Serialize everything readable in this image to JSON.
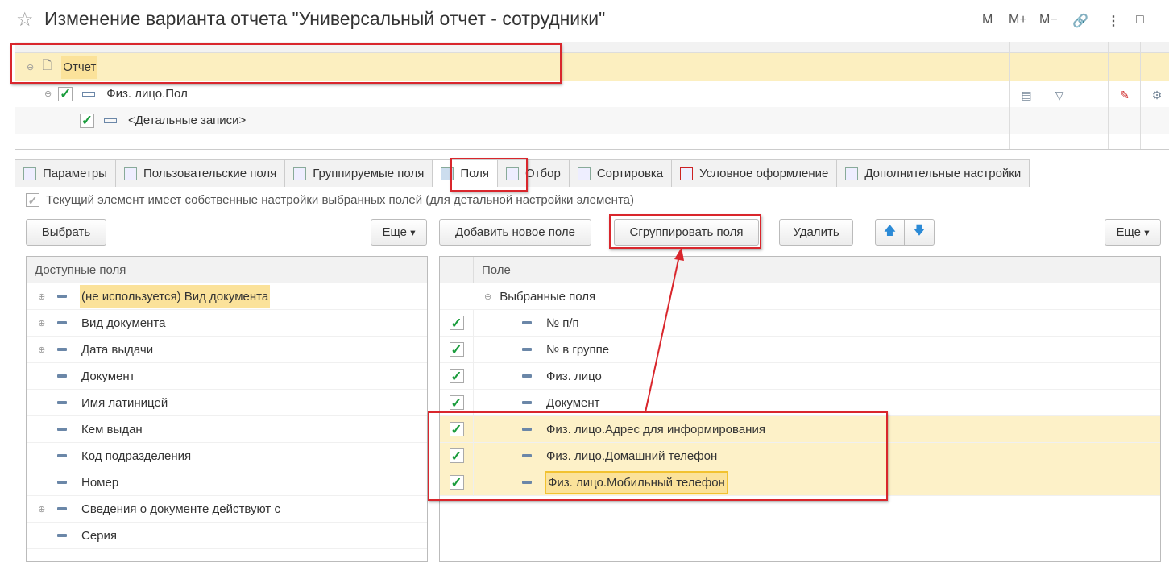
{
  "window": {
    "title": "Изменение варианта отчета \"Универсальный отчет - сотрудники\"",
    "toolbar": [
      "M",
      "M+",
      "M−",
      "🔗",
      "⋮",
      "□"
    ]
  },
  "structure": {
    "rows": [
      {
        "label": "Отчет"
      },
      {
        "label": "Физ. лицо.Пол"
      },
      {
        "label": "<Детальные записи>"
      }
    ]
  },
  "tabs": [
    {
      "label": "Параметры"
    },
    {
      "label": "Пользовательские поля"
    },
    {
      "label": "Группируемые поля"
    },
    {
      "label": "Поля",
      "active": true
    },
    {
      "label": "Отбор"
    },
    {
      "label": "Сортировка"
    },
    {
      "label": "Условное оформление"
    },
    {
      "label": "Дополнительные настройки"
    }
  ],
  "own_settings": {
    "label": "Текущий элемент имеет собственные настройки выбранных полей (для детальной настройки элемента)",
    "checked": true
  },
  "left": {
    "choose": "Выбрать",
    "more": "Еще",
    "header": "Доступные поля",
    "items": [
      {
        "label": "(не используется) Вид документа",
        "expandable": true,
        "highlight": true
      },
      {
        "label": "Вид документа",
        "expandable": true
      },
      {
        "label": "Дата выдачи",
        "expandable": true
      },
      {
        "label": "Документ"
      },
      {
        "label": "Имя латиницей"
      },
      {
        "label": "Кем выдан"
      },
      {
        "label": "Код подразделения"
      },
      {
        "label": "Номер"
      },
      {
        "label": "Сведения о документе действуют с",
        "expandable": true
      },
      {
        "label": "Серия"
      }
    ]
  },
  "right": {
    "add": "Добавить новое поле",
    "group": "Сгруппировать поля",
    "delete": "Удалить",
    "up": "🡅",
    "down": "🡇",
    "more": "Еще",
    "header": "Поле",
    "root": "Выбранные поля",
    "items": [
      {
        "label": "№ п/п"
      },
      {
        "label": "№ в группе"
      },
      {
        "label": "Физ. лицо"
      },
      {
        "label": "Документ"
      },
      {
        "label": "Физ. лицо.Адрес для информирования",
        "selected": true
      },
      {
        "label": "Физ. лицо.Домашний телефон",
        "selected": true
      },
      {
        "label": "Физ. лицо.Мобильный телефон",
        "selected": true,
        "current": true
      }
    ]
  }
}
